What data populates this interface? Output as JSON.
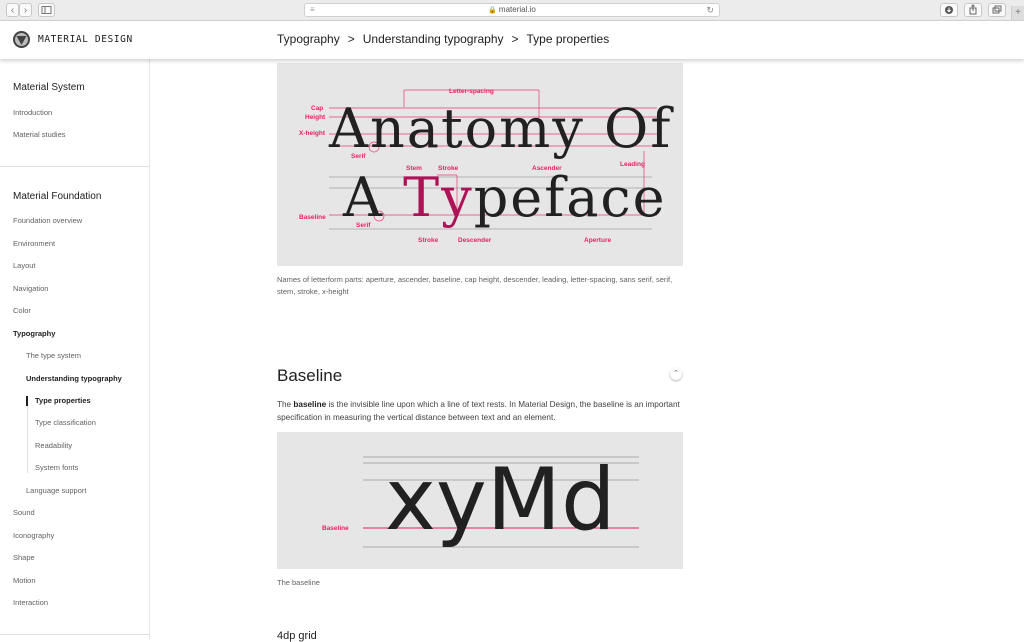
{
  "browser": {
    "url": "material.io",
    "back_glyph": "‹",
    "forward_glyph": "›",
    "reload_glyph": "↻",
    "new_tab_glyph": "+"
  },
  "header": {
    "brand": "MATERIAL DESIGN",
    "breadcrumb": [
      "Typography",
      "Understanding typography",
      "Type properties"
    ],
    "separator": ">"
  },
  "sidebar": {
    "section1_title": "Material System",
    "section1_items": [
      "Introduction",
      "Material studies"
    ],
    "section2_title": "Material Foundation",
    "items": [
      "Foundation overview",
      "Environment",
      "Layout",
      "Navigation",
      "Color",
      "Typography"
    ],
    "typography_children": [
      "The type system",
      "Understanding typography"
    ],
    "understanding_children": [
      "Type properties",
      "Type classification",
      "Readability",
      "System fonts"
    ],
    "after_items": [
      "Language support",
      "Sound",
      "Iconography",
      "Shape",
      "Motion",
      "Interaction"
    ]
  },
  "figure1": {
    "line1": "Anatomy Of",
    "line2_a": "A ",
    "line2_b": "Ty",
    "line2_c": "peface",
    "labels": {
      "letter_spacing": "Letter-spacing",
      "cap_height": "Cap",
      "cap_height2": "Height",
      "x_height": "X-height",
      "serif_top": "Serif",
      "stem": "Stem",
      "stroke_top": "Stroke",
      "ascender": "Ascender",
      "leading": "Leading",
      "baseline": "Baseline",
      "serif_bottom": "Serif",
      "stroke_bottom": "Stroke",
      "descender": "Descender",
      "aperture": "Aperture"
    },
    "caption": "Names of letterform parts: aperture, ascender, baseline, cap height, descender, leading, letter-spacing, sans serif, serif, stem, stroke, x-height"
  },
  "section": {
    "title": "Baseline",
    "para_pre": "The ",
    "para_bold": "baseline",
    "para_post": " is the invisible line upon which a line of text rests. In Material Design, the baseline is an important specification in measuring the vertical distance between text and an element.",
    "collapse_glyph": "⌃"
  },
  "figure2": {
    "text": "xyMd",
    "label": "Baseline",
    "caption": "The baseline"
  },
  "next_heading": "4dp grid",
  "colors": {
    "accent": "#e91e63",
    "dark_accent": "#ad1457",
    "figure_bg": "#e6e6e6"
  }
}
